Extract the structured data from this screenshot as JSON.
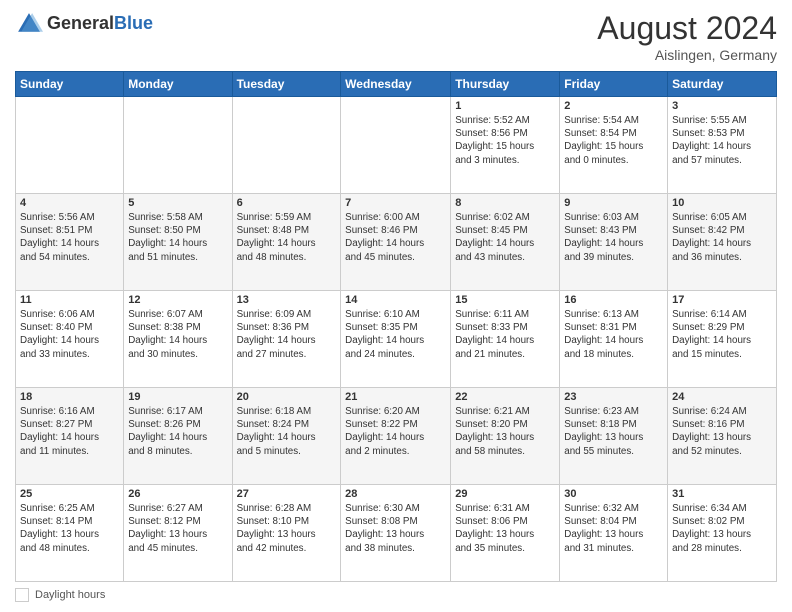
{
  "header": {
    "logo_general": "General",
    "logo_blue": "Blue",
    "month_year": "August 2024",
    "location": "Aislingen, Germany"
  },
  "footer": {
    "daylight_label": "Daylight hours"
  },
  "days_of_week": [
    "Sunday",
    "Monday",
    "Tuesday",
    "Wednesday",
    "Thursday",
    "Friday",
    "Saturday"
  ],
  "weeks": [
    [
      {
        "day": "",
        "info": ""
      },
      {
        "day": "",
        "info": ""
      },
      {
        "day": "",
        "info": ""
      },
      {
        "day": "",
        "info": ""
      },
      {
        "day": "1",
        "info": "Sunrise: 5:52 AM\nSunset: 8:56 PM\nDaylight: 15 hours\nand 3 minutes."
      },
      {
        "day": "2",
        "info": "Sunrise: 5:54 AM\nSunset: 8:54 PM\nDaylight: 15 hours\nand 0 minutes."
      },
      {
        "day": "3",
        "info": "Sunrise: 5:55 AM\nSunset: 8:53 PM\nDaylight: 14 hours\nand 57 minutes."
      }
    ],
    [
      {
        "day": "4",
        "info": "Sunrise: 5:56 AM\nSunset: 8:51 PM\nDaylight: 14 hours\nand 54 minutes."
      },
      {
        "day": "5",
        "info": "Sunrise: 5:58 AM\nSunset: 8:50 PM\nDaylight: 14 hours\nand 51 minutes."
      },
      {
        "day": "6",
        "info": "Sunrise: 5:59 AM\nSunset: 8:48 PM\nDaylight: 14 hours\nand 48 minutes."
      },
      {
        "day": "7",
        "info": "Sunrise: 6:00 AM\nSunset: 8:46 PM\nDaylight: 14 hours\nand 45 minutes."
      },
      {
        "day": "8",
        "info": "Sunrise: 6:02 AM\nSunset: 8:45 PM\nDaylight: 14 hours\nand 43 minutes."
      },
      {
        "day": "9",
        "info": "Sunrise: 6:03 AM\nSunset: 8:43 PM\nDaylight: 14 hours\nand 39 minutes."
      },
      {
        "day": "10",
        "info": "Sunrise: 6:05 AM\nSunset: 8:42 PM\nDaylight: 14 hours\nand 36 minutes."
      }
    ],
    [
      {
        "day": "11",
        "info": "Sunrise: 6:06 AM\nSunset: 8:40 PM\nDaylight: 14 hours\nand 33 minutes."
      },
      {
        "day": "12",
        "info": "Sunrise: 6:07 AM\nSunset: 8:38 PM\nDaylight: 14 hours\nand 30 minutes."
      },
      {
        "day": "13",
        "info": "Sunrise: 6:09 AM\nSunset: 8:36 PM\nDaylight: 14 hours\nand 27 minutes."
      },
      {
        "day": "14",
        "info": "Sunrise: 6:10 AM\nSunset: 8:35 PM\nDaylight: 14 hours\nand 24 minutes."
      },
      {
        "day": "15",
        "info": "Sunrise: 6:11 AM\nSunset: 8:33 PM\nDaylight: 14 hours\nand 21 minutes."
      },
      {
        "day": "16",
        "info": "Sunrise: 6:13 AM\nSunset: 8:31 PM\nDaylight: 14 hours\nand 18 minutes."
      },
      {
        "day": "17",
        "info": "Sunrise: 6:14 AM\nSunset: 8:29 PM\nDaylight: 14 hours\nand 15 minutes."
      }
    ],
    [
      {
        "day": "18",
        "info": "Sunrise: 6:16 AM\nSunset: 8:27 PM\nDaylight: 14 hours\nand 11 minutes."
      },
      {
        "day": "19",
        "info": "Sunrise: 6:17 AM\nSunset: 8:26 PM\nDaylight: 14 hours\nand 8 minutes."
      },
      {
        "day": "20",
        "info": "Sunrise: 6:18 AM\nSunset: 8:24 PM\nDaylight: 14 hours\nand 5 minutes."
      },
      {
        "day": "21",
        "info": "Sunrise: 6:20 AM\nSunset: 8:22 PM\nDaylight: 14 hours\nand 2 minutes."
      },
      {
        "day": "22",
        "info": "Sunrise: 6:21 AM\nSunset: 8:20 PM\nDaylight: 13 hours\nand 58 minutes."
      },
      {
        "day": "23",
        "info": "Sunrise: 6:23 AM\nSunset: 8:18 PM\nDaylight: 13 hours\nand 55 minutes."
      },
      {
        "day": "24",
        "info": "Sunrise: 6:24 AM\nSunset: 8:16 PM\nDaylight: 13 hours\nand 52 minutes."
      }
    ],
    [
      {
        "day": "25",
        "info": "Sunrise: 6:25 AM\nSunset: 8:14 PM\nDaylight: 13 hours\nand 48 minutes."
      },
      {
        "day": "26",
        "info": "Sunrise: 6:27 AM\nSunset: 8:12 PM\nDaylight: 13 hours\nand 45 minutes."
      },
      {
        "day": "27",
        "info": "Sunrise: 6:28 AM\nSunset: 8:10 PM\nDaylight: 13 hours\nand 42 minutes."
      },
      {
        "day": "28",
        "info": "Sunrise: 6:30 AM\nSunset: 8:08 PM\nDaylight: 13 hours\nand 38 minutes."
      },
      {
        "day": "29",
        "info": "Sunrise: 6:31 AM\nSunset: 8:06 PM\nDaylight: 13 hours\nand 35 minutes."
      },
      {
        "day": "30",
        "info": "Sunrise: 6:32 AM\nSunset: 8:04 PM\nDaylight: 13 hours\nand 31 minutes."
      },
      {
        "day": "31",
        "info": "Sunrise: 6:34 AM\nSunset: 8:02 PM\nDaylight: 13 hours\nand 28 minutes."
      }
    ]
  ]
}
